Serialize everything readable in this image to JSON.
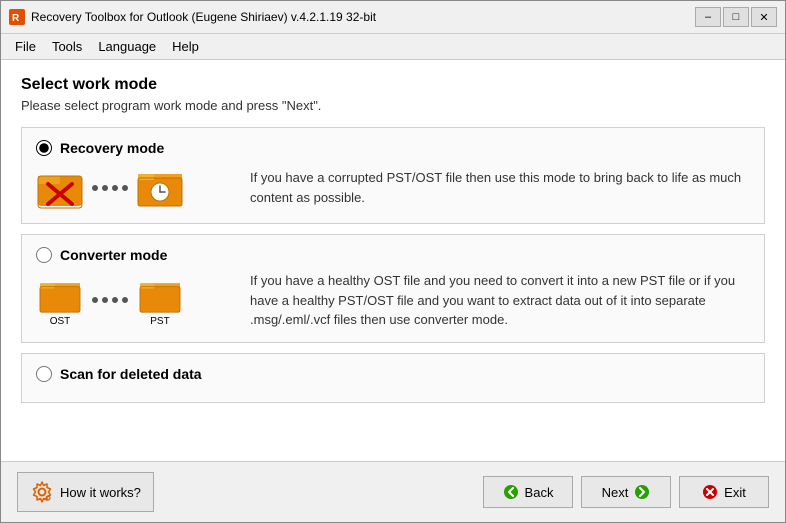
{
  "titleBar": {
    "title": "Recovery Toolbox for Outlook (Eugene Shiriaev) v.4.2.1.19 32-bit",
    "minBtn": "–",
    "maxBtn": "□",
    "closeBtn": "✕"
  },
  "menuBar": {
    "items": [
      "File",
      "Tools",
      "Language",
      "Help"
    ]
  },
  "header": {
    "title": "Select work mode",
    "subtitle": "Please select program work mode and press \"Next\"."
  },
  "modes": [
    {
      "id": "recovery",
      "label": "Recovery mode",
      "checked": true,
      "description": "If you have a corrupted PST/OST file then use this mode to bring back to life as much content as possible."
    },
    {
      "id": "converter",
      "label": "Converter mode",
      "checked": false,
      "description": "If you have a healthy OST file and you need to convert it into a new PST file or if you have a healthy PST/OST file and you want to extract data out of it into separate .msg/.eml/.vcf files then use converter mode.",
      "fromLabel": "OST",
      "toLabel": "PST"
    },
    {
      "id": "scan",
      "label": "Scan for deleted data",
      "checked": false
    }
  ],
  "footer": {
    "howItWorksLabel": "How it works?",
    "backLabel": "Back",
    "nextLabel": "Next",
    "exitLabel": "Exit"
  }
}
